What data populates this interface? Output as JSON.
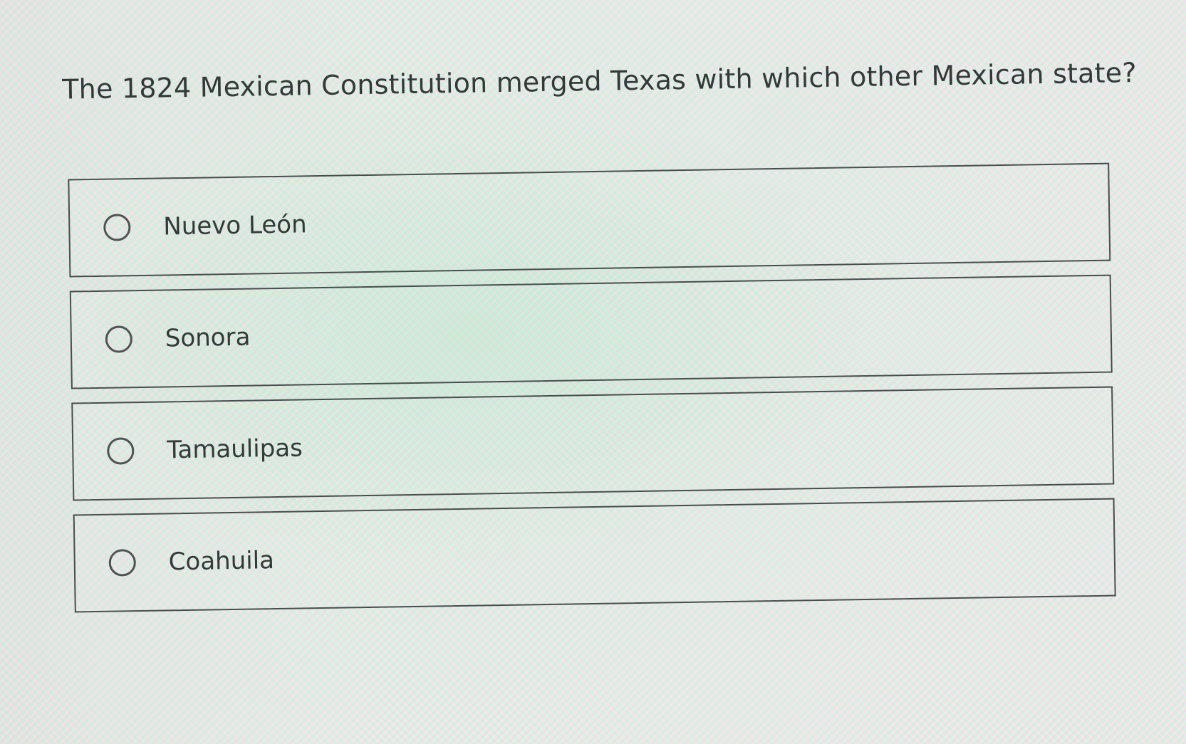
{
  "question": {
    "text": "The 1824 Mexican Constitution merged Texas with which other Mexican state?"
  },
  "options": [
    {
      "label": "Nuevo León",
      "icon": "radio-unselected-icon",
      "selected": false
    },
    {
      "label": "Sonora",
      "icon": "radio-unselected-icon",
      "selected": false
    },
    {
      "label": "Tamaulipas",
      "icon": "radio-unselected-icon",
      "selected": false
    },
    {
      "label": "Coahuila",
      "icon": "radio-unselected-icon",
      "selected": false
    }
  ],
  "colors": {
    "text": "#333a3a",
    "border": "#4a4d4d",
    "background": "#eef0ee"
  }
}
